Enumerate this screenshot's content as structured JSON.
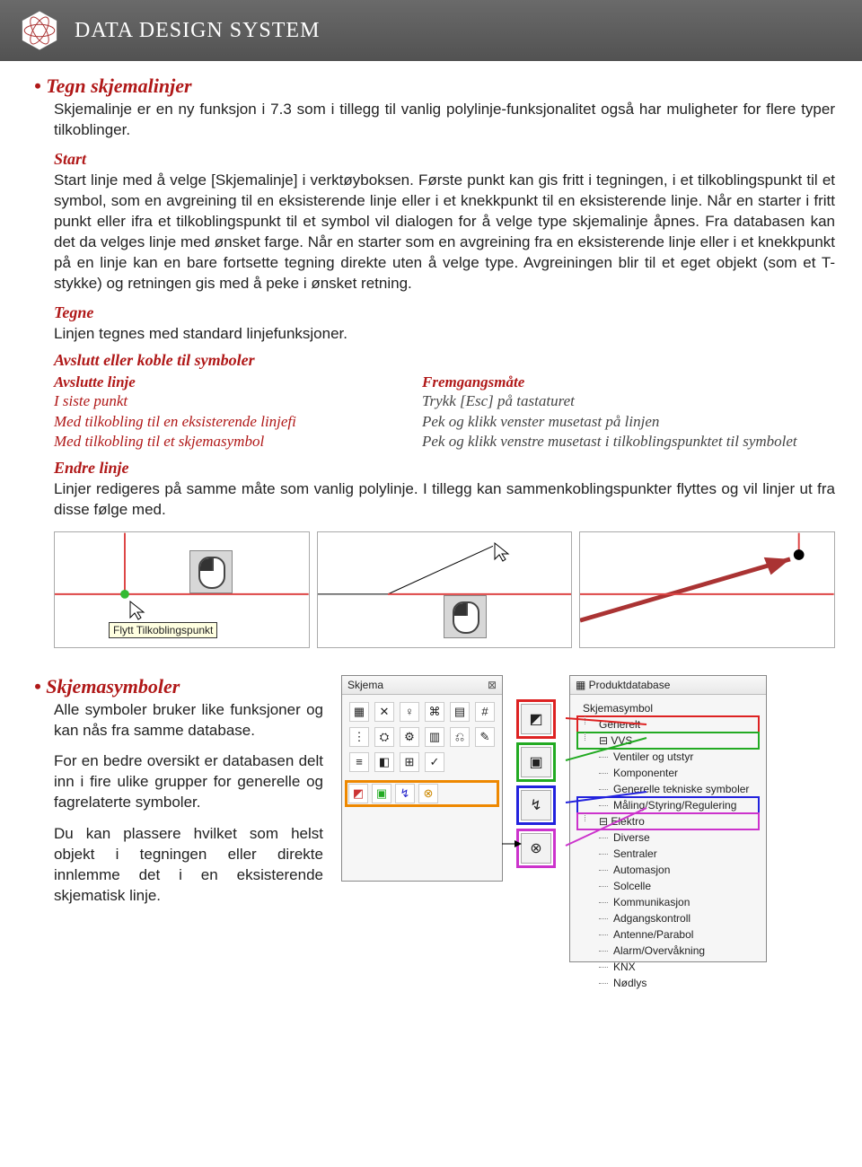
{
  "header": {
    "brand": "DATA DESIGN SYSTEM"
  },
  "sec1": {
    "title": "Tegn skjemalinjer",
    "intro": "Skjemalinje er en ny funksjon i 7.3 som i tillegg til vanlig polylinje-funksjonalitet også har muligheter for flere typer tilkoblinger.",
    "start_h": "Start",
    "start_p": "Start linje med å velge [Skjemalinje] i verktøyboksen. Første punkt kan gis fritt i tegningen, i et tilkoblingspunkt til et symbol, som en avgreining til en eksisterende linje eller i et knekkpunkt til en eksisterende linje. Når en starter i fritt punkt eller ifra et tilkoblingspunkt til et symbol vil dialogen for å velge type skjemalinje åpnes. Fra databasen kan det da velges linje med ønsket farge. Når en starter som en avgreining fra en eksisterende linje eller i et knekkpunkt på en linje kan en bare fortsette tegning direkte uten å velge type. Avgreiningen blir til et eget objekt (som et T-stykke) og retningen gis med å peke i ønsket retning.",
    "tegne_h": "Tegne",
    "tegne_p": "Linjen tegnes med standard linjefunksjoner.",
    "avslutt_h": "Avslutt eller koble til symboler",
    "col_left_h": "Avslutte linje",
    "col_left_1": "I siste punkt",
    "col_left_2": "Med tilkobling til en eksisterende linjefi",
    "col_left_3": "Med tilkobling til et skjemasymbol",
    "col_right_h": "Fremgangsmåte",
    "col_right_1": "Trykk [Esc] på tastaturet",
    "col_right_2": "Pek og klikk venster musetast på linjen",
    "col_right_3": "Pek og klikk venstre musetast i tilkoblingspunktet til symbolet",
    "endre_h": "Endre linje",
    "endre_p": "Linjer redigeres på samme måte som vanlig polylinje. I tillegg kan sammenkoblingspunkter flyttes og vil linjer ut fra disse følge med.",
    "tooltip": "Flytt Tilkoblingspunkt"
  },
  "sec2": {
    "title": "Skjemasymboler",
    "p1": "Alle symboler bruker like funksjoner og kan nås fra samme database.",
    "p2": "For en bedre oversikt er databasen delt inn i fire ulike grupper for generelle og fagrelaterte symboler.",
    "p3": "Du kan plassere hvilket som helst objekt i tegningen eller direkte innlemme det i en eksisterende skjematisk linje.",
    "toolbox_title": "Skjema",
    "tree_title": "Produktdatabase",
    "tree": {
      "root": "Skjemasymbol",
      "generelt": "Generelt",
      "vvs": "VVS",
      "vvs_children": [
        "Ventiler og utstyr",
        "Komponenter",
        "Generelle tekniske symboler",
        "Måling/Styring/Regulering"
      ],
      "elektro": "Elektro",
      "elektro_children": [
        "Diverse",
        "Sentraler",
        "Automasjon",
        "Solcelle",
        "Kommunikasjon",
        "Adgangskontroll",
        "Antenne/Parabol",
        "Alarm/Overvåkning",
        "KNX",
        "Nødlys"
      ]
    }
  }
}
